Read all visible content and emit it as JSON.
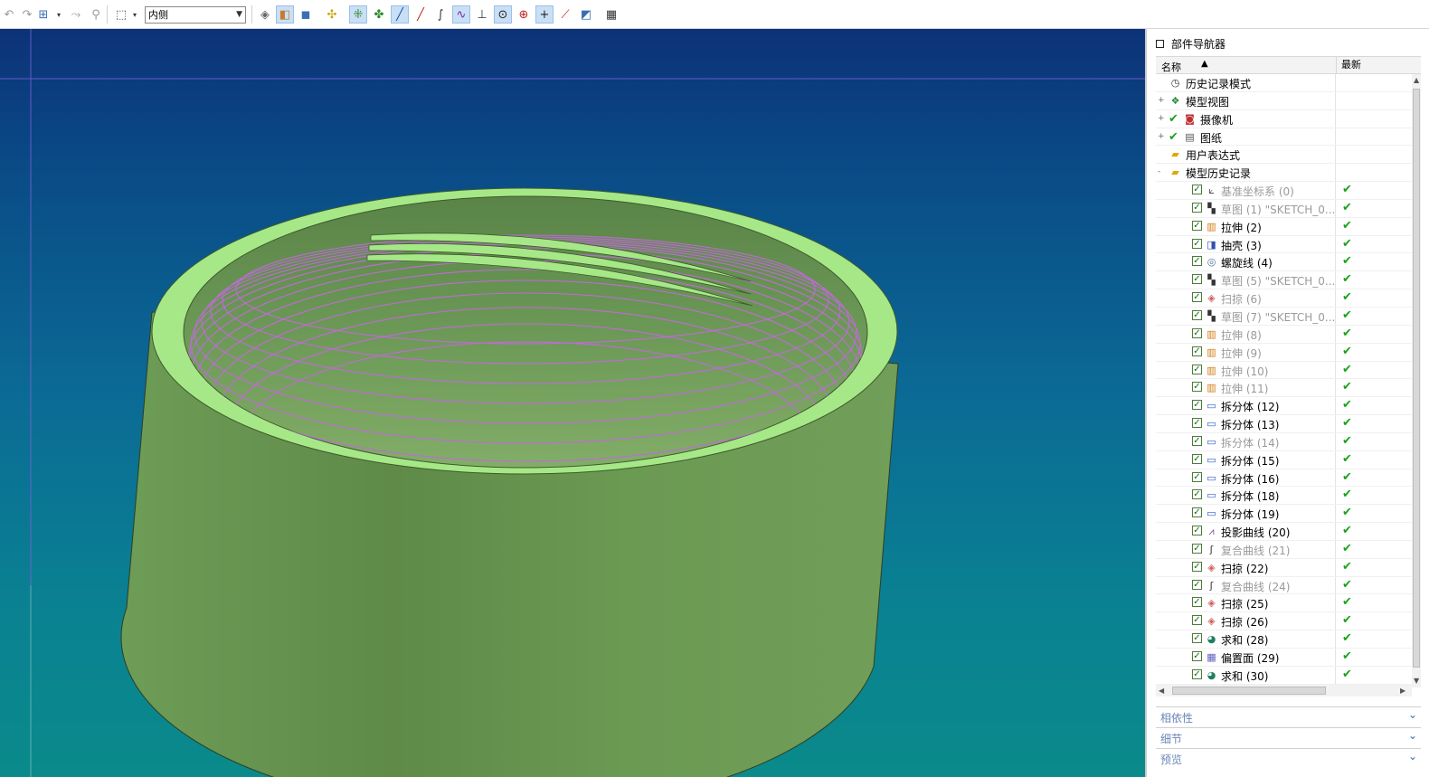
{
  "toolbar": {
    "selection_filter": "内侧"
  },
  "navigator": {
    "title": "部件导航器",
    "col_name": "名称",
    "col_latest": "最新",
    "nodes": [
      {
        "label": "历史记录模式",
        "icon": "clock-icon",
        "level": 0
      },
      {
        "label": "模型视图",
        "icon": "model-views-icon",
        "level": 0,
        "expand": "+"
      },
      {
        "label": "摄像机",
        "icon": "camera-icon",
        "level": 0,
        "expand": "+",
        "check": true
      },
      {
        "label": "图纸",
        "icon": "drawing-icon",
        "level": 0,
        "expand": "+",
        "check": true
      },
      {
        "label": "用户表达式",
        "icon": "folder-icon",
        "level": 0
      },
      {
        "label": "模型历史记录",
        "icon": "folder-open-icon",
        "level": 0,
        "expand": "-"
      }
    ],
    "features": [
      {
        "label": "基准坐标系 (0)",
        "icon": "datum-csys-icon",
        "dim": true
      },
      {
        "label": "草图 (1) \"SKETCH_0...",
        "icon": "sketch-icon",
        "dim": true
      },
      {
        "label": "拉伸 (2)",
        "icon": "extrude-icon",
        "dim": false
      },
      {
        "label": "抽壳 (3)",
        "icon": "shell-icon",
        "dim": false
      },
      {
        "label": "螺旋线 (4)",
        "icon": "helix-icon",
        "dim": false
      },
      {
        "label": "草图 (5) \"SKETCH_0...",
        "icon": "sketch-icon",
        "dim": true
      },
      {
        "label": "扫掠 (6)",
        "icon": "sweep-icon",
        "dim": true
      },
      {
        "label": "草图 (7) \"SKETCH_0...",
        "icon": "sketch-icon",
        "dim": true
      },
      {
        "label": "拉伸 (8)",
        "icon": "extrude-icon",
        "dim": true
      },
      {
        "label": "拉伸 (9)",
        "icon": "extrude-icon",
        "dim": true
      },
      {
        "label": "拉伸 (10)",
        "icon": "extrude-icon",
        "dim": true
      },
      {
        "label": "拉伸 (11)",
        "icon": "extrude-icon",
        "dim": true
      },
      {
        "label": "拆分体 (12)",
        "icon": "split-body-icon",
        "dim": false
      },
      {
        "label": "拆分体 (13)",
        "icon": "split-body-icon",
        "dim": false
      },
      {
        "label": "拆分体 (14)",
        "icon": "split-body-icon",
        "dim": true
      },
      {
        "label": "拆分体 (15)",
        "icon": "split-body-icon",
        "dim": false
      },
      {
        "label": "拆分体 (16)",
        "icon": "split-body-icon",
        "dim": false
      },
      {
        "label": "拆分体 (18)",
        "icon": "split-body-icon",
        "dim": false
      },
      {
        "label": "拆分体 (19)",
        "icon": "split-body-icon",
        "dim": false
      },
      {
        "label": "投影曲线 (20)",
        "icon": "projected-curve-icon",
        "dim": false
      },
      {
        "label": "复合曲线 (21)",
        "icon": "composite-curve-icon",
        "dim": true
      },
      {
        "label": "扫掠 (22)",
        "icon": "sweep-icon",
        "dim": false
      },
      {
        "label": "复合曲线 (24)",
        "icon": "composite-curve-icon",
        "dim": true
      },
      {
        "label": "扫掠 (25)",
        "icon": "sweep-icon",
        "dim": false
      },
      {
        "label": "扫掠 (26)",
        "icon": "sweep-icon",
        "dim": false
      },
      {
        "label": "求和 (28)",
        "icon": "unite-icon",
        "dim": false
      },
      {
        "label": "偏置面 (29)",
        "icon": "offset-face-icon",
        "dim": false
      },
      {
        "label": "求和 (30)",
        "icon": "unite-icon",
        "dim": false
      }
    ]
  },
  "panels": [
    {
      "label": "相依性"
    },
    {
      "label": "细节"
    },
    {
      "label": "预览"
    }
  ],
  "colors": {
    "part_body": "#6e9a56",
    "part_top_face": "#a6e887",
    "thread_lines": "#c06ad8",
    "check_green": "#19a319"
  }
}
